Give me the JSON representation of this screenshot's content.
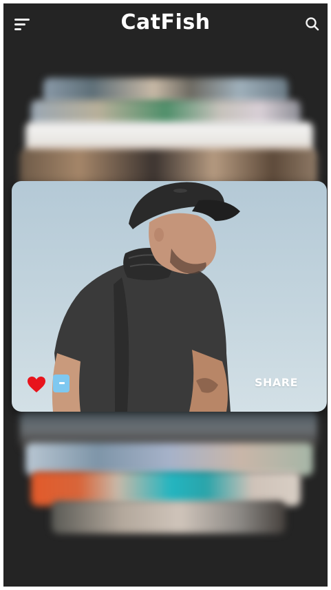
{
  "header": {
    "title": "CatFish",
    "menu_icon": "menu-icon",
    "search_icon": "search-icon"
  },
  "card": {
    "like_icon": "heart-icon",
    "chat_icon": "chat-icon",
    "share_label": "SHARE"
  },
  "colors": {
    "background": "#242424",
    "title": "#ffffff",
    "heart": "#e8141c",
    "chat": "#7ec8f0",
    "share": "#ffffff"
  }
}
